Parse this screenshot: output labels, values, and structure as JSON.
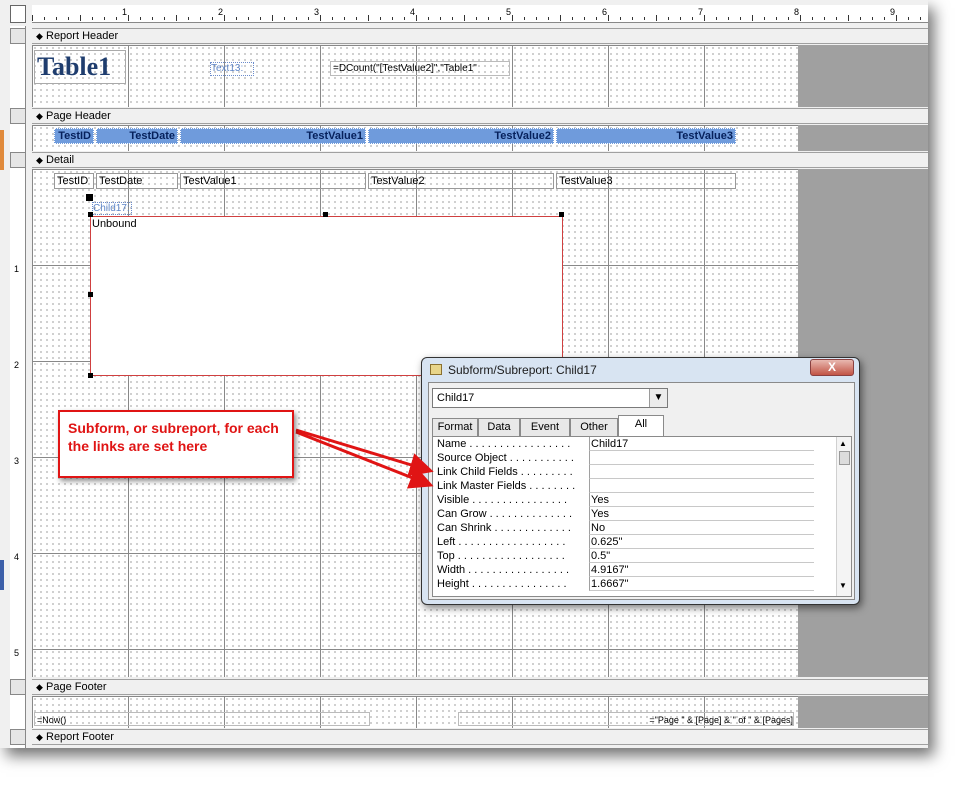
{
  "ruler": {
    "numbers": [
      "1",
      "2",
      "3",
      "4",
      "5",
      "6",
      "7",
      "8",
      "9"
    ],
    "vnumbers": [
      "1",
      "2",
      "3",
      "4",
      "5"
    ]
  },
  "sections": {
    "report_header": "Report Header",
    "page_header": "Page Header",
    "detail": "Detail",
    "page_footer": "Page Footer",
    "report_footer": "Report Footer"
  },
  "report_header": {
    "title": "Table1",
    "text_label": "Text13:",
    "count_expr": "=DCount(\"[TestValue2]\",\"Table1\""
  },
  "page_header": {
    "columns": [
      "TestID",
      "TestDate",
      "TestValue1",
      "TestValue2",
      "TestValue3"
    ]
  },
  "detail": {
    "fields": [
      "TestID",
      "TestDate",
      "TestValue1",
      "TestValue2",
      "TestValue3"
    ],
    "child_label": "Child17:",
    "subreport_text": "Unbound"
  },
  "page_footer": {
    "now_expr": "=Now()",
    "page_expr": "=\"Page \" & [Page] & \" of \" & [Pages]"
  },
  "dialog": {
    "title": "Subform/Subreport: Child17",
    "close_label": "X",
    "selected_object": "Child17",
    "tabs": [
      "Format",
      "Data",
      "Event",
      "Other",
      "All"
    ],
    "active_tab": "All",
    "properties": [
      {
        "name": "Name . . . . . . . . . . . . . . . . .",
        "value": "Child17"
      },
      {
        "name": "Source Object . . . . . . . . . . .",
        "value": ""
      },
      {
        "name": "Link Child Fields . . . . . . . . .",
        "value": ""
      },
      {
        "name": "Link Master Fields . . . . . . . .",
        "value": ""
      },
      {
        "name": "Visible . . . . . . . . . . . . . . . .",
        "value": "Yes"
      },
      {
        "name": "Can Grow . . . . . . . . . . . . . .",
        "value": "Yes"
      },
      {
        "name": "Can Shrink . . . . . . . . . . . . .",
        "value": "No"
      },
      {
        "name": "Left . . . . . . . . . . . . . . . . . .",
        "value": "0.625\""
      },
      {
        "name": "Top . . . . . . . . . . . . . . . . . .",
        "value": "0.5\""
      },
      {
        "name": "Width . . . . . . . . . . . . . . . . .",
        "value": "4.9167\""
      },
      {
        "name": "Height . . . . . . . . . . . . . . . .",
        "value": "1.6667\""
      }
    ]
  },
  "callout": {
    "text": "Subform, or subreport, for each the links are set here",
    "color": "#e01414"
  }
}
